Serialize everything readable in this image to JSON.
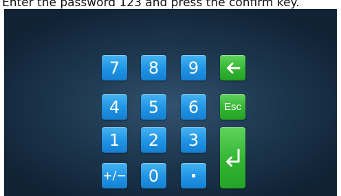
{
  "instruction": "Enter the password 123 and press the confirm key.",
  "keypad": {
    "key_7": "7",
    "key_8": "8",
    "key_9": "9",
    "key_4": "4",
    "key_5": "5",
    "key_6": "6",
    "key_1": "1",
    "key_2": "2",
    "key_3": "3",
    "plus_minus": "+/−",
    "key_0": "0",
    "esc": "Esc",
    "backspace_icon": "left-arrow-icon",
    "enter_icon": "enter-return-icon",
    "decimal_icon": "dot-icon"
  },
  "colors": {
    "number_key": "#1f93e4",
    "action_key": "#33b533",
    "background": "#1f3a52"
  }
}
